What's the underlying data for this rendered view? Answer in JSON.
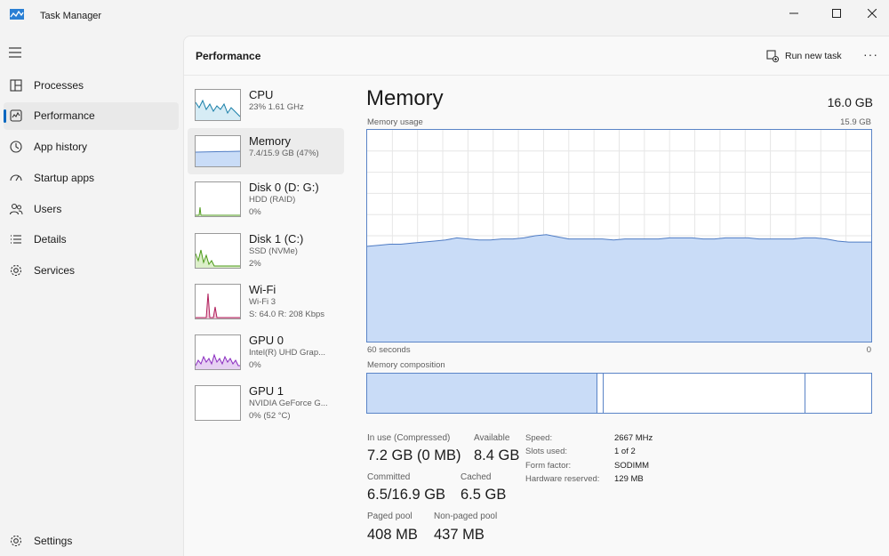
{
  "window": {
    "title": "Task Manager",
    "minimize": "—",
    "maximize": "☐",
    "close": "✕"
  },
  "sidebar": {
    "items": [
      {
        "label": "Processes"
      },
      {
        "label": "Performance"
      },
      {
        "label": "App history"
      },
      {
        "label": "Startup apps"
      },
      {
        "label": "Users"
      },
      {
        "label": "Details"
      },
      {
        "label": "Services"
      }
    ],
    "settings": "Settings",
    "active_index": 1
  },
  "header": {
    "title": "Performance",
    "run_new_task": "Run new task",
    "more": "···"
  },
  "devices": [
    {
      "name": "CPU",
      "line1": "23%  1.61 GHz",
      "line2": ""
    },
    {
      "name": "Memory",
      "line1": "7.4/15.9 GB (47%)",
      "line2": ""
    },
    {
      "name": "Disk 0 (D: G:)",
      "line1": "HDD (RAID)",
      "line2": "0%"
    },
    {
      "name": "Disk 1 (C:)",
      "line1": "SSD (NVMe)",
      "line2": "2%"
    },
    {
      "name": "Wi-Fi",
      "line1": "Wi-Fi 3",
      "line2": "S: 64.0  R: 208 Kbps"
    },
    {
      "name": "GPU 0",
      "line1": "Intel(R) UHD Grap...",
      "line2": "0%"
    },
    {
      "name": "GPU 1",
      "line1": "NVIDIA GeForce G...",
      "line2": "0%  (52 °C)"
    }
  ],
  "memory": {
    "title": "Memory",
    "total": "16.0 GB",
    "usage_label": "Memory usage",
    "usage_max": "15.9 GB",
    "time_left": "60 seconds",
    "time_right": "0",
    "composition_label": "Memory composition",
    "composition": {
      "in_use": 0.457,
      "modified": 0.012,
      "standby": 0.4,
      "free": 0.131
    },
    "usage_history_fraction": [
      0.45,
      0.455,
      0.46,
      0.46,
      0.465,
      0.47,
      0.475,
      0.48,
      0.49,
      0.485,
      0.48,
      0.48,
      0.485,
      0.485,
      0.49,
      0.5,
      0.505,
      0.495,
      0.485,
      0.485,
      0.485,
      0.485,
      0.48,
      0.485,
      0.485,
      0.485,
      0.485,
      0.49,
      0.49,
      0.49,
      0.485,
      0.485,
      0.49,
      0.49,
      0.49,
      0.485,
      0.485,
      0.485,
      0.485,
      0.49,
      0.49,
      0.485,
      0.475,
      0.47,
      0.47,
      0.47
    ],
    "stats": {
      "in_use_label": "In use (Compressed)",
      "in_use": "7.2 GB (0 MB)",
      "available_label": "Available",
      "available": "8.4 GB",
      "committed_label": "Committed",
      "committed": "6.5/16.9 GB",
      "cached_label": "Cached",
      "cached": "6.5 GB",
      "paged_label": "Paged pool",
      "paged": "408 MB",
      "nonpaged_label": "Non-paged pool",
      "nonpaged": "437 MB"
    },
    "details": [
      {
        "key": "Speed:",
        "value": "2667 MHz"
      },
      {
        "key": "Slots used:",
        "value": "1 of 2"
      },
      {
        "key": "Form factor:",
        "value": "SODIMM"
      },
      {
        "key": "Hardware reserved:",
        "value": "129 MB"
      }
    ]
  },
  "colors": {
    "accent": "#0067c0",
    "memory_fill": "#c9dcf7",
    "memory_line": "#4f7cc4",
    "cpu": "#177ea8",
    "disk1": "#4d9a1a",
    "wifi": "#b01e5b",
    "gpu": "#8a2cbf"
  }
}
